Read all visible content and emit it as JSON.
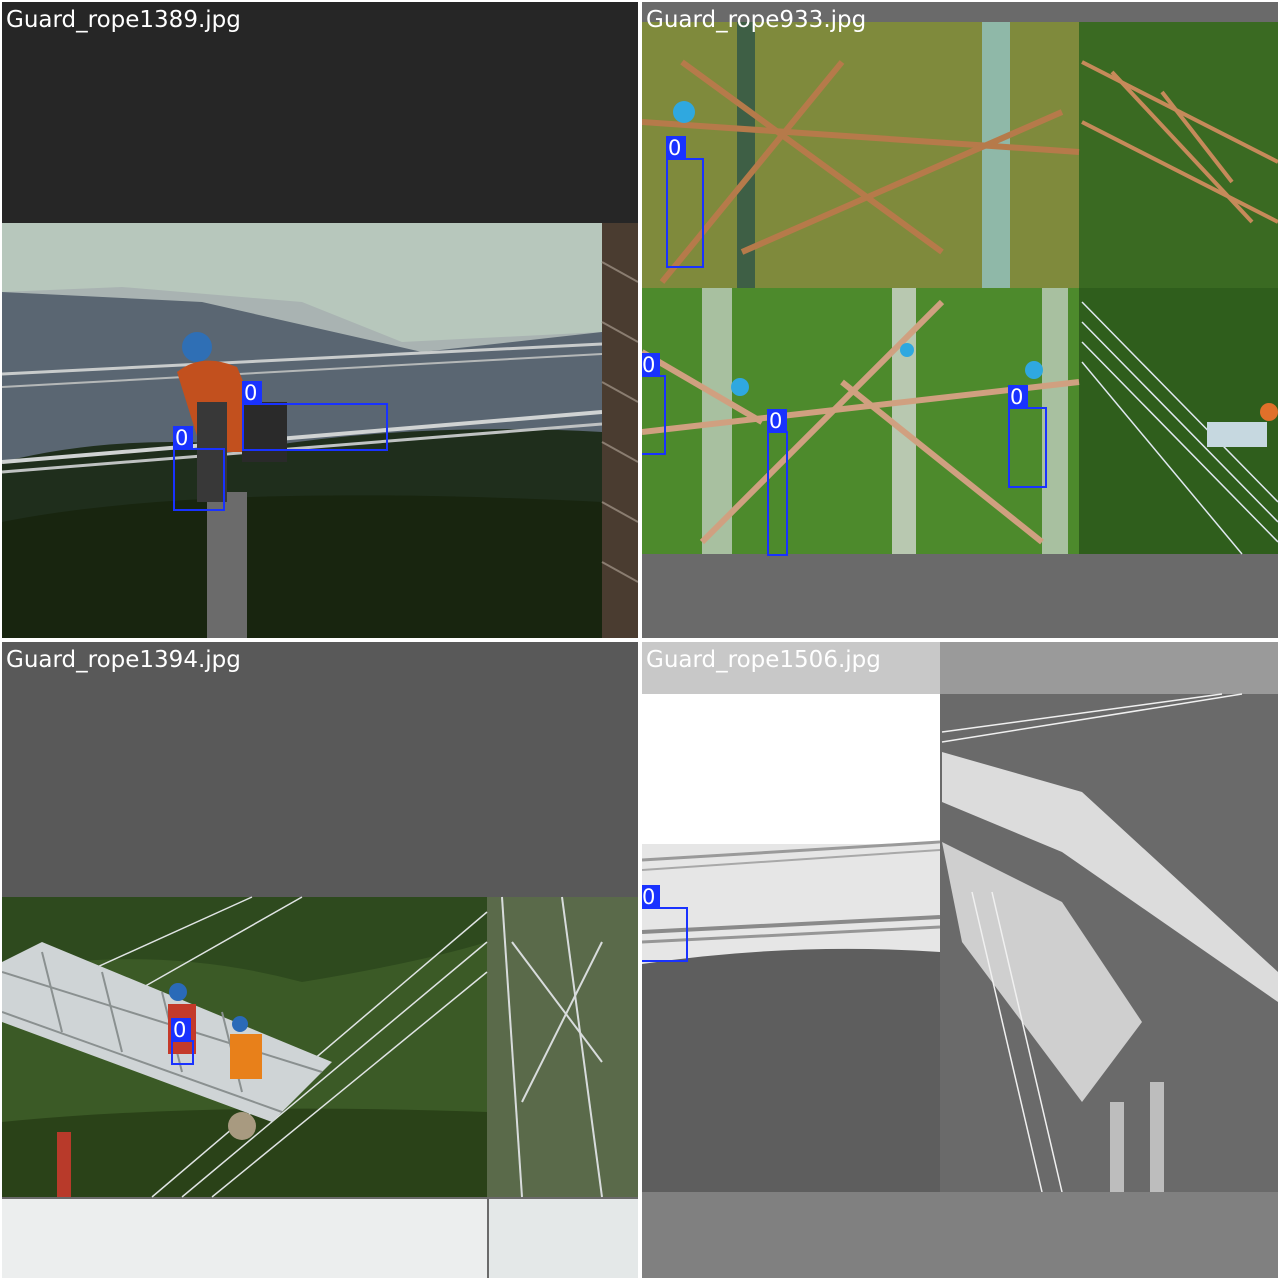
{
  "tiles": [
    {
      "filename": "Guard_rope1389.jpg",
      "boxes": [
        {
          "label": "0"
        },
        {
          "label": "0"
        }
      ]
    },
    {
      "filename": "Guard_rope933.jpg",
      "boxes": [
        {
          "label": "0"
        },
        {
          "label": "0"
        },
        {
          "label": "0"
        },
        {
          "label": "0"
        }
      ]
    },
    {
      "filename": "Guard_rope1394.jpg",
      "boxes": [
        {
          "label": "0"
        }
      ]
    },
    {
      "filename": "Guard_rope1506.jpg",
      "boxes": [
        {
          "label": "0"
        }
      ]
    }
  ],
  "colors": {
    "box": "#1932ff",
    "label_text": "#ffffff",
    "padding_gray": "#6a6a6a",
    "padding_dark": "#262626"
  }
}
